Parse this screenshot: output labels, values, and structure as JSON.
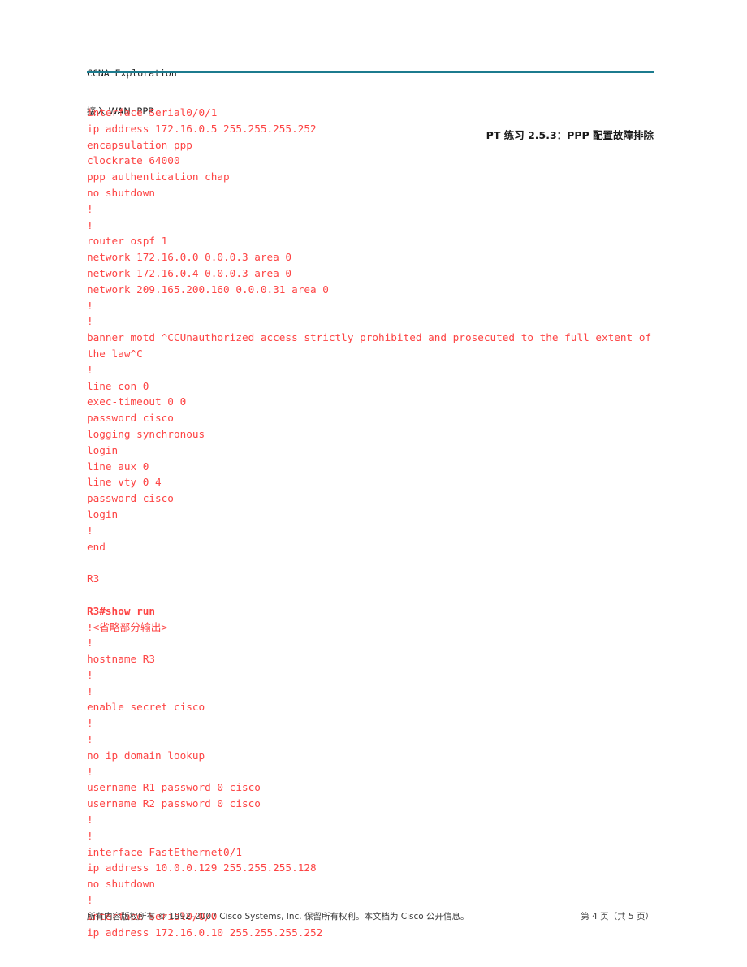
{
  "document": {
    "header": {
      "course_line1": "CCNA Exploration",
      "course_line2": "接入 WAN: PPP",
      "title": "PT 练习 2.5.3：PPP 配置故障排除",
      "rule_color": "#1c7b8e"
    },
    "body_color": "#fd4444",
    "config_lines": [
      {
        "text": "interface Serial0/0/1",
        "bold": false
      },
      {
        "text": "ip address 172.16.0.5 255.255.255.252",
        "bold": false
      },
      {
        "text": "encapsulation ppp",
        "bold": false
      },
      {
        "text": "clockrate 64000",
        "bold": false
      },
      {
        "text": "ppp authentication chap",
        "bold": false
      },
      {
        "text": "no shutdown",
        "bold": false
      },
      {
        "text": "!",
        "bold": false
      },
      {
        "text": "!",
        "bold": false
      },
      {
        "text": "router ospf 1",
        "bold": false
      },
      {
        "text": "network 172.16.0.0 0.0.0.3 area 0",
        "bold": false
      },
      {
        "text": "network 172.16.0.4 0.0.0.3 area 0",
        "bold": false
      },
      {
        "text": "network 209.165.200.160 0.0.0.31 area 0",
        "bold": false
      },
      {
        "text": "!",
        "bold": false
      },
      {
        "text": "!",
        "bold": false
      },
      {
        "text": "banner motd ^CCUnauthorized access strictly prohibited and prosecuted to the full extent of the law^C",
        "bold": false,
        "wrap": true
      },
      {
        "text": "!",
        "bold": false
      },
      {
        "text": "line con 0",
        "bold": false
      },
      {
        "text": "exec-timeout 0 0",
        "bold": false
      },
      {
        "text": "password cisco",
        "bold": false
      },
      {
        "text": "logging synchronous",
        "bold": false
      },
      {
        "text": "login",
        "bold": false
      },
      {
        "text": "line aux 0",
        "bold": false
      },
      {
        "text": "line vty 0 4",
        "bold": false
      },
      {
        "text": "password cisco",
        "bold": false
      },
      {
        "text": "login",
        "bold": false
      },
      {
        "text": "!",
        "bold": false
      },
      {
        "text": "end",
        "bold": false
      },
      {
        "text": "",
        "bold": false,
        "blank": true
      },
      {
        "text": "R3",
        "bold": false
      },
      {
        "text": "",
        "bold": false,
        "blank": true
      },
      {
        "text": "R3#show run",
        "bold": true
      },
      {
        "text": "!<省略部分输出>",
        "bold": false,
        "cjk": true
      },
      {
        "text": "!",
        "bold": false
      },
      {
        "text": "hostname R3",
        "bold": false
      },
      {
        "text": "!",
        "bold": false
      },
      {
        "text": "!",
        "bold": false
      },
      {
        "text": "enable secret cisco",
        "bold": false
      },
      {
        "text": "!",
        "bold": false
      },
      {
        "text": "!",
        "bold": false
      },
      {
        "text": "no ip domain lookup",
        "bold": false
      },
      {
        "text": "!",
        "bold": false
      },
      {
        "text": "username R1 password 0 cisco",
        "bold": false
      },
      {
        "text": "username R2 password 0 cisco",
        "bold": false
      },
      {
        "text": "!",
        "bold": false
      },
      {
        "text": "!",
        "bold": false
      },
      {
        "text": "interface FastEthernet0/1",
        "bold": false
      },
      {
        "text": "ip address 10.0.0.129 255.255.255.128",
        "bold": false
      },
      {
        "text": "no shutdown",
        "bold": false
      },
      {
        "text": "!",
        "bold": false
      },
      {
        "text": "interface Serial0/0/0",
        "bold": false
      },
      {
        "text": "ip address 172.16.0.10 255.255.255.252",
        "bold": false
      }
    ],
    "footer": {
      "copyright": "所有内容版权所有 © 1992–2007 Cisco Systems, Inc. 保留所有权利。本文档为 Cisco 公开信息。",
      "page_number": "第 4 页（共 5 页）"
    }
  }
}
